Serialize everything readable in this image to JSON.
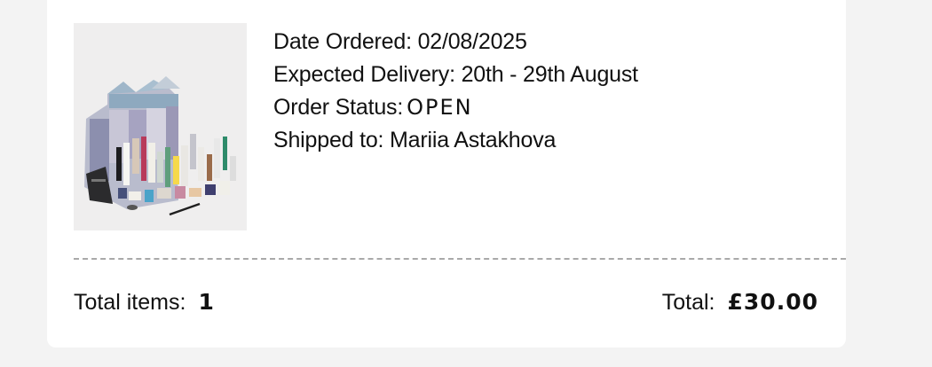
{
  "order": {
    "date_ordered_label": "Date Ordered:",
    "date_ordered_value": "02/08/2025",
    "expected_delivery_label": "Expected Delivery:",
    "expected_delivery_value": "20th - 29th August",
    "status_label": "Order Status:",
    "status_value": "OPEN",
    "shipped_to_label": "Shipped to:",
    "shipped_to_value": "Mariia Astakhova"
  },
  "summary": {
    "total_items_label": "Total items:",
    "total_items_value": "1",
    "total_label": "Total:",
    "total_value": "£30.00"
  },
  "colors": {
    "page_background": "#f3f3f3",
    "card_background": "#ffffff",
    "divider": "#a9a9a9"
  }
}
